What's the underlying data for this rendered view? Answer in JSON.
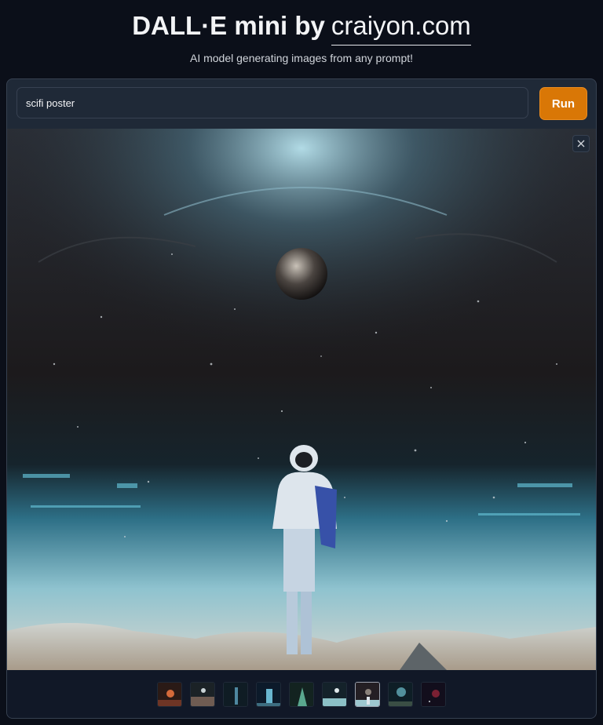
{
  "header": {
    "title_prefix": "DALL·E mini by",
    "title_link": "craiyon.com",
    "subtitle": "AI model generating images from any prompt!"
  },
  "prompt": {
    "value": "scifi poster",
    "run_label": "Run"
  },
  "viewer": {
    "image_name": "generated-image",
    "close_icon": "close-icon"
  },
  "thumbnails": {
    "count": 9,
    "selected_index": 6
  },
  "colors": {
    "background": "#0b0f19",
    "panel": "#1f2937",
    "run_button": "#d97706"
  }
}
